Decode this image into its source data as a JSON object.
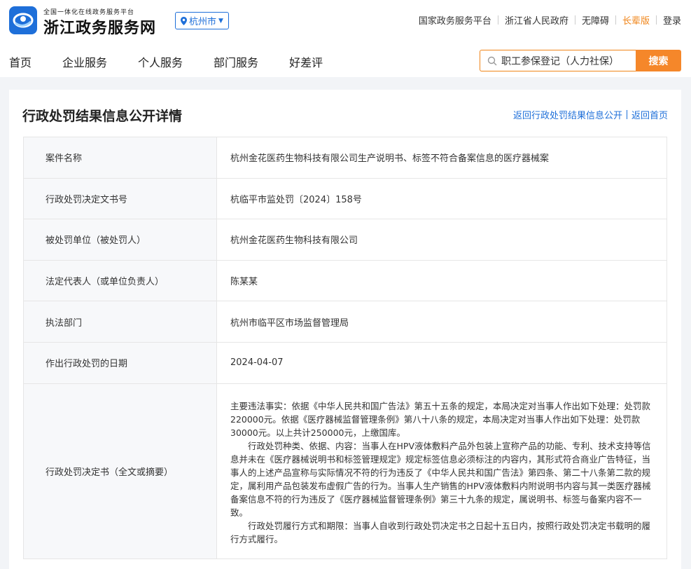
{
  "header": {
    "logo_small": "全国一体化在线政务服务平台",
    "logo_title": "浙江政务服务网",
    "city": "杭州市",
    "top_links": [
      "国家政务服务平台",
      "浙江省人民政府",
      "无障碍",
      "长辈版",
      "登录"
    ],
    "accent_color": "#1e6fd9",
    "highlight_color": "#f08519"
  },
  "nav": {
    "items": [
      "首页",
      "企业服务",
      "个人服务",
      "部门服务",
      "好差评"
    ]
  },
  "search": {
    "value": "职工参保登记（人力社保）",
    "button": "搜索"
  },
  "page": {
    "title": "行政处罚结果信息公开详情",
    "crumbs": [
      "返回行政处罚结果信息公开",
      "返回首页"
    ]
  },
  "detail": {
    "rows": [
      {
        "label": "案件名称",
        "value": "杭州金花医药生物科技有限公司生产说明书、标签不符合备案信息的医疗器械案"
      },
      {
        "label": "行政处罚决定文书号",
        "value": "杭临平市监处罚〔2024〕158号"
      },
      {
        "label": "被处罚单位（被处罚人）",
        "value": "杭州金花医药生物科技有限公司"
      },
      {
        "label": "法定代表人（或单位负责人）",
        "value": "陈某某"
      },
      {
        "label": "执法部门",
        "value": "杭州市临平区市场监督管理局"
      },
      {
        "label": "作出行政处罚的日期",
        "value": "2024-04-07"
      }
    ],
    "decision_label": "行政处罚决定书（全文或摘要）",
    "decision_paragraphs": [
      "主要违法事实：依据《中华人民共和国广告法》第五十五条的规定，本局决定对当事人作出如下处理：处罚款220000元。依据《医疗器械监督管理条例》第八十八条的规定，本局决定对当事人作出如下处理：处罚款30000元。以上共计250000元，上缴国库。",
      "行政处罚种类、依据、内容：当事人在HPV液体敷料产品外包装上宣称产品的功能、专利、技术支持等信息并未在《医疗器械说明书和标签管理规定》规定标签信息必须标注的内容内，其形式符合商业广告特征，当事人的上述产品宣称与实际情况不符的行为违反了《中华人民共和国广告法》第四条、第二十八条第二款的规定，属利用产品包装发布虚假广告的行为。当事人生产销售的HPV液体敷料内附说明书内容与其一类医疗器械备案信息不符的行为违反了《医疗器械监督管理条例》第三十九条的规定，属说明书、标签与备案内容不一致。",
      "行政处罚履行方式和期限：当事人自收到行政处罚决定书之日起十五日内，按照行政处罚决定书载明的履行方式履行。"
    ]
  }
}
